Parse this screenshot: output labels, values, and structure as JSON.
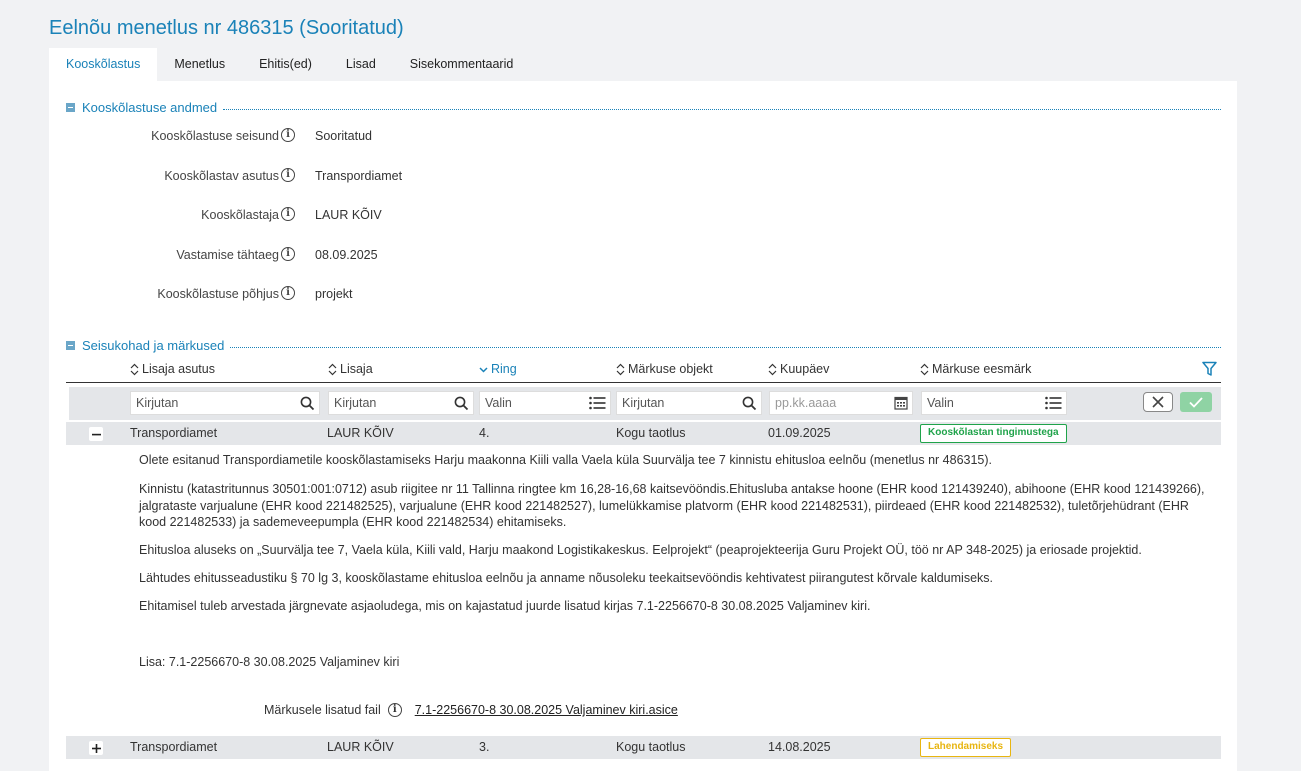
{
  "page": {
    "title": "Eelnõu menetlus nr 486315 (Sooritatud)"
  },
  "tabs": [
    {
      "label": "Kooskõlastus",
      "active": true
    },
    {
      "label": "Menetlus"
    },
    {
      "label": "Ehitis(ed)"
    },
    {
      "label": "Lisad"
    },
    {
      "label": "Sisekommentaarid"
    }
  ],
  "section1": {
    "title": "Kooskõlastuse andmed",
    "fields": [
      {
        "label": "Kooskõlastuse seisund",
        "value": "Sooritatud"
      },
      {
        "label": "Kooskõlastav asutus",
        "value": "Transpordiamet"
      },
      {
        "label": "Kooskõlastaja",
        "value": "LAUR KÕIV"
      },
      {
        "label": "Vastamise tähtaeg",
        "value": "08.09.2025"
      },
      {
        "label": "Kooskõlastuse põhjus",
        "value": "projekt"
      }
    ]
  },
  "section2": {
    "title": "Seisukohad ja märkused",
    "columns": [
      "Lisaja asutus",
      "Lisaja",
      "Ring",
      "Märkuse objekt",
      "Kuupäev",
      "Märkuse eesmärk"
    ],
    "filters": {
      "lisaja_asutus": "Kirjutan",
      "lisaja": "Kirjutan",
      "ring": "Valin",
      "objekt": "Kirjutan",
      "kuupaev": "pp.kk.aaaa",
      "eesmark": "Valin"
    },
    "rows": [
      {
        "asutus": "Transpordiamet",
        "lisaja": "LAUR KÕIV",
        "ring": "4.",
        "objekt": "Kogu taotlus",
        "kuupaev": "01.09.2025",
        "eesmark": "Kooskõlastan tingimustega",
        "eesmark_color": "#1fa34a",
        "expanded": true
      },
      {
        "asutus": "Transpordiamet",
        "lisaja": "LAUR KÕIV",
        "ring": "3.",
        "objekt": "Kogu taotlus",
        "kuupaev": "14.08.2025",
        "eesmark": "Lahendamiseks",
        "eesmark_color": "#e8b511",
        "expanded": false
      }
    ],
    "detail": {
      "paragraphs": [
        "Olete esitanud Transpordiametile kooskõlastamiseks Harju maakonna Kiili valla Vaela küla Suurvälja tee 7 kinnistu ehitusloa eelnõu (menetlus nr 486315).",
        "Kinnistu (katastritunnus 30501:001:0712) asub riigitee nr 11 Tallinna ringtee km 16,28-16,68 kaitsevööndis.Ehitusluba antakse hoone (EHR kood 121439240), abihoone (EHR kood 121439266), jalgratastе varjualune (EHR kood 221482525), varjualune (EHR kood 221482527), lumelükkamise platvorm (EHR kood 221482531), piirdeaed (EHR kood 221482532), tuletõrjehüdrant (EHR kood 221482533) ja sademeveepumpla (EHR kood 221482534) ehitamiseks.",
        "Ehitusloa aluseks on „Suurvälja tee 7, Vaela küla, Kiili vald, Harju maakond Logistikakeskus. Eelprojekt“ (peaprojekteerija Guru Projekt OÜ, töö nr AP 348-2025) ja eriosade projektid.",
        "Lähtudes ehitusseadustiku § 70 lg 3, kooskõlastame ehitusloa eelnõu ja anname nõusoleku teekaitsevööndis kehtivatest piirangutest kõrvale kaldumiseks.",
        "Ehitamisel tuleb arvestada järgnevate asjaoludega, mis on kajastatud juurde lisatud kirjas 7.1-2256670-8 30.08.2025 Valjaminev kiri.",
        "Lisa: 7.1-2256670-8 30.08.2025 Valjaminev kiri"
      ],
      "file_label": "Märkusele lisatud fail",
      "file_name": "7.1-2256670-8 30.08.2025 Valjaminev kiri.asice"
    }
  }
}
